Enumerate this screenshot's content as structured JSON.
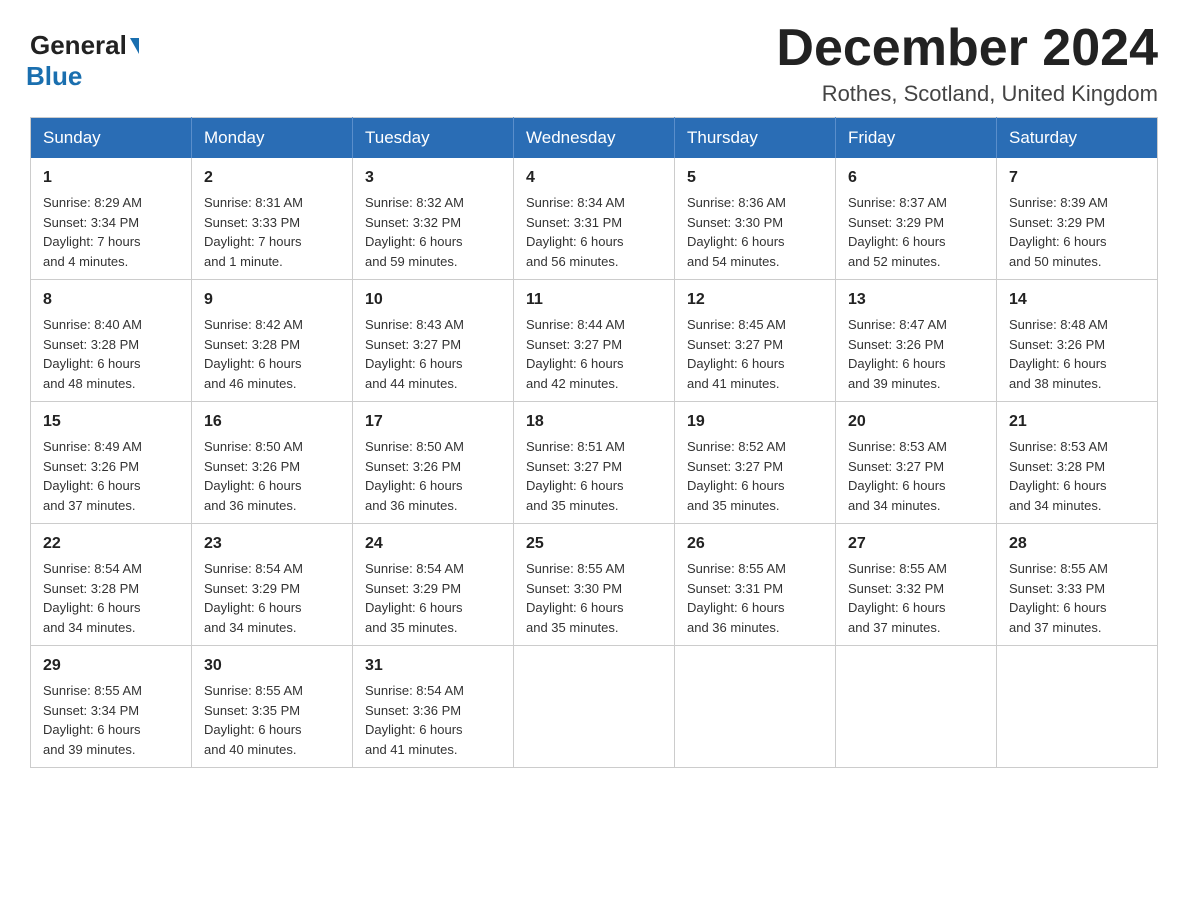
{
  "header": {
    "logo_general": "General",
    "logo_blue": "Blue",
    "month_title": "December 2024",
    "location": "Rothes, Scotland, United Kingdom"
  },
  "days_of_week": [
    "Sunday",
    "Monday",
    "Tuesday",
    "Wednesday",
    "Thursday",
    "Friday",
    "Saturday"
  ],
  "weeks": [
    [
      {
        "day": "1",
        "sunrise": "Sunrise: 8:29 AM",
        "sunset": "Sunset: 3:34 PM",
        "daylight": "Daylight: 7 hours",
        "daylight2": "and 4 minutes."
      },
      {
        "day": "2",
        "sunrise": "Sunrise: 8:31 AM",
        "sunset": "Sunset: 3:33 PM",
        "daylight": "Daylight: 7 hours",
        "daylight2": "and 1 minute."
      },
      {
        "day": "3",
        "sunrise": "Sunrise: 8:32 AM",
        "sunset": "Sunset: 3:32 PM",
        "daylight": "Daylight: 6 hours",
        "daylight2": "and 59 minutes."
      },
      {
        "day": "4",
        "sunrise": "Sunrise: 8:34 AM",
        "sunset": "Sunset: 3:31 PM",
        "daylight": "Daylight: 6 hours",
        "daylight2": "and 56 minutes."
      },
      {
        "day": "5",
        "sunrise": "Sunrise: 8:36 AM",
        "sunset": "Sunset: 3:30 PM",
        "daylight": "Daylight: 6 hours",
        "daylight2": "and 54 minutes."
      },
      {
        "day": "6",
        "sunrise": "Sunrise: 8:37 AM",
        "sunset": "Sunset: 3:29 PM",
        "daylight": "Daylight: 6 hours",
        "daylight2": "and 52 minutes."
      },
      {
        "day": "7",
        "sunrise": "Sunrise: 8:39 AM",
        "sunset": "Sunset: 3:29 PM",
        "daylight": "Daylight: 6 hours",
        "daylight2": "and 50 minutes."
      }
    ],
    [
      {
        "day": "8",
        "sunrise": "Sunrise: 8:40 AM",
        "sunset": "Sunset: 3:28 PM",
        "daylight": "Daylight: 6 hours",
        "daylight2": "and 48 minutes."
      },
      {
        "day": "9",
        "sunrise": "Sunrise: 8:42 AM",
        "sunset": "Sunset: 3:28 PM",
        "daylight": "Daylight: 6 hours",
        "daylight2": "and 46 minutes."
      },
      {
        "day": "10",
        "sunrise": "Sunrise: 8:43 AM",
        "sunset": "Sunset: 3:27 PM",
        "daylight": "Daylight: 6 hours",
        "daylight2": "and 44 minutes."
      },
      {
        "day": "11",
        "sunrise": "Sunrise: 8:44 AM",
        "sunset": "Sunset: 3:27 PM",
        "daylight": "Daylight: 6 hours",
        "daylight2": "and 42 minutes."
      },
      {
        "day": "12",
        "sunrise": "Sunrise: 8:45 AM",
        "sunset": "Sunset: 3:27 PM",
        "daylight": "Daylight: 6 hours",
        "daylight2": "and 41 minutes."
      },
      {
        "day": "13",
        "sunrise": "Sunrise: 8:47 AM",
        "sunset": "Sunset: 3:26 PM",
        "daylight": "Daylight: 6 hours",
        "daylight2": "and 39 minutes."
      },
      {
        "day": "14",
        "sunrise": "Sunrise: 8:48 AM",
        "sunset": "Sunset: 3:26 PM",
        "daylight": "Daylight: 6 hours",
        "daylight2": "and 38 minutes."
      }
    ],
    [
      {
        "day": "15",
        "sunrise": "Sunrise: 8:49 AM",
        "sunset": "Sunset: 3:26 PM",
        "daylight": "Daylight: 6 hours",
        "daylight2": "and 37 minutes."
      },
      {
        "day": "16",
        "sunrise": "Sunrise: 8:50 AM",
        "sunset": "Sunset: 3:26 PM",
        "daylight": "Daylight: 6 hours",
        "daylight2": "and 36 minutes."
      },
      {
        "day": "17",
        "sunrise": "Sunrise: 8:50 AM",
        "sunset": "Sunset: 3:26 PM",
        "daylight": "Daylight: 6 hours",
        "daylight2": "and 36 minutes."
      },
      {
        "day": "18",
        "sunrise": "Sunrise: 8:51 AM",
        "sunset": "Sunset: 3:27 PM",
        "daylight": "Daylight: 6 hours",
        "daylight2": "and 35 minutes."
      },
      {
        "day": "19",
        "sunrise": "Sunrise: 8:52 AM",
        "sunset": "Sunset: 3:27 PM",
        "daylight": "Daylight: 6 hours",
        "daylight2": "and 35 minutes."
      },
      {
        "day": "20",
        "sunrise": "Sunrise: 8:53 AM",
        "sunset": "Sunset: 3:27 PM",
        "daylight": "Daylight: 6 hours",
        "daylight2": "and 34 minutes."
      },
      {
        "day": "21",
        "sunrise": "Sunrise: 8:53 AM",
        "sunset": "Sunset: 3:28 PM",
        "daylight": "Daylight: 6 hours",
        "daylight2": "and 34 minutes."
      }
    ],
    [
      {
        "day": "22",
        "sunrise": "Sunrise: 8:54 AM",
        "sunset": "Sunset: 3:28 PM",
        "daylight": "Daylight: 6 hours",
        "daylight2": "and 34 minutes."
      },
      {
        "day": "23",
        "sunrise": "Sunrise: 8:54 AM",
        "sunset": "Sunset: 3:29 PM",
        "daylight": "Daylight: 6 hours",
        "daylight2": "and 34 minutes."
      },
      {
        "day": "24",
        "sunrise": "Sunrise: 8:54 AM",
        "sunset": "Sunset: 3:29 PM",
        "daylight": "Daylight: 6 hours",
        "daylight2": "and 35 minutes."
      },
      {
        "day": "25",
        "sunrise": "Sunrise: 8:55 AM",
        "sunset": "Sunset: 3:30 PM",
        "daylight": "Daylight: 6 hours",
        "daylight2": "and 35 minutes."
      },
      {
        "day": "26",
        "sunrise": "Sunrise: 8:55 AM",
        "sunset": "Sunset: 3:31 PM",
        "daylight": "Daylight: 6 hours",
        "daylight2": "and 36 minutes."
      },
      {
        "day": "27",
        "sunrise": "Sunrise: 8:55 AM",
        "sunset": "Sunset: 3:32 PM",
        "daylight": "Daylight: 6 hours",
        "daylight2": "and 37 minutes."
      },
      {
        "day": "28",
        "sunrise": "Sunrise: 8:55 AM",
        "sunset": "Sunset: 3:33 PM",
        "daylight": "Daylight: 6 hours",
        "daylight2": "and 37 minutes."
      }
    ],
    [
      {
        "day": "29",
        "sunrise": "Sunrise: 8:55 AM",
        "sunset": "Sunset: 3:34 PM",
        "daylight": "Daylight: 6 hours",
        "daylight2": "and 39 minutes."
      },
      {
        "day": "30",
        "sunrise": "Sunrise: 8:55 AM",
        "sunset": "Sunset: 3:35 PM",
        "daylight": "Daylight: 6 hours",
        "daylight2": "and 40 minutes."
      },
      {
        "day": "31",
        "sunrise": "Sunrise: 8:54 AM",
        "sunset": "Sunset: 3:36 PM",
        "daylight": "Daylight: 6 hours",
        "daylight2": "and 41 minutes."
      },
      {
        "day": "",
        "sunrise": "",
        "sunset": "",
        "daylight": "",
        "daylight2": ""
      },
      {
        "day": "",
        "sunrise": "",
        "sunset": "",
        "daylight": "",
        "daylight2": ""
      },
      {
        "day": "",
        "sunrise": "",
        "sunset": "",
        "daylight": "",
        "daylight2": ""
      },
      {
        "day": "",
        "sunrise": "",
        "sunset": "",
        "daylight": "",
        "daylight2": ""
      }
    ]
  ]
}
